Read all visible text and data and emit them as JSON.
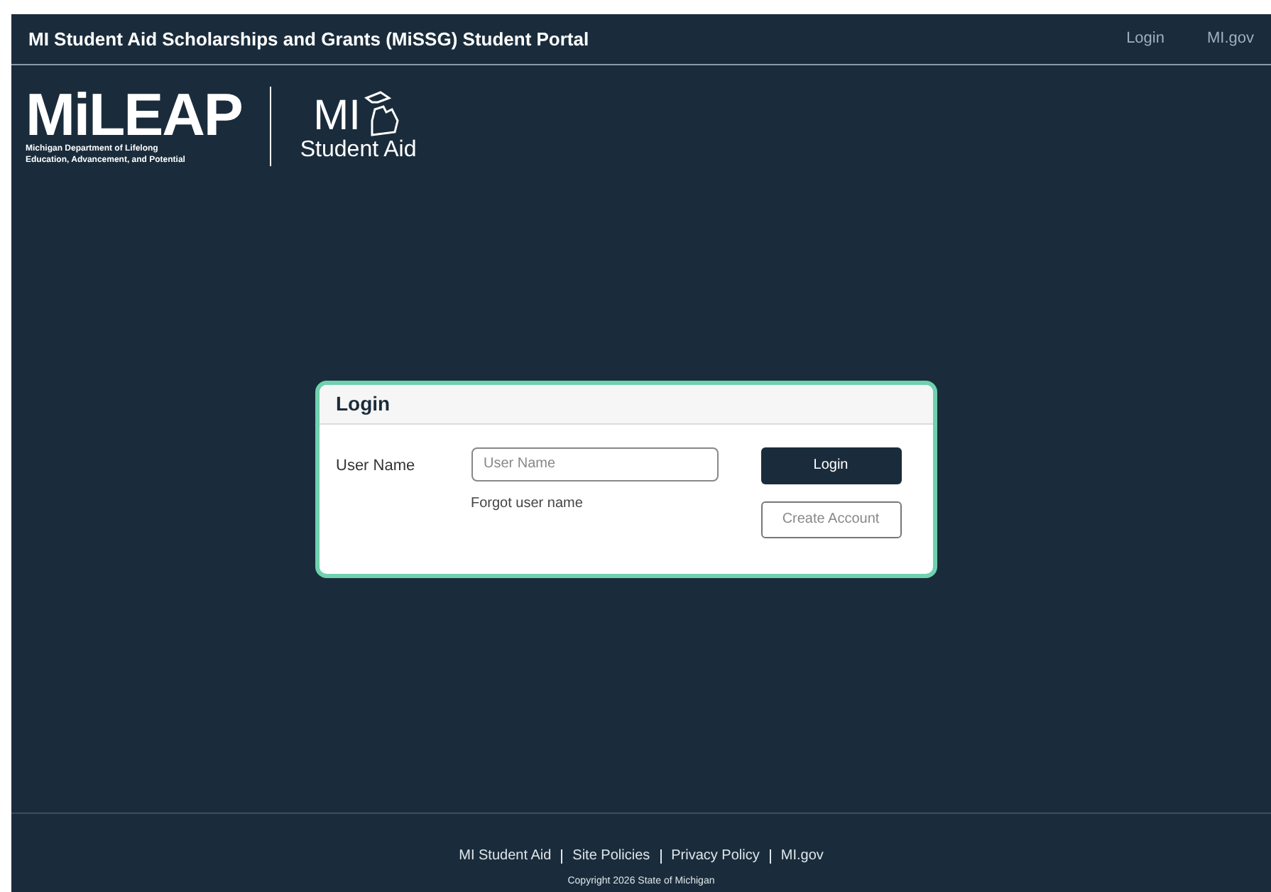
{
  "header": {
    "title": "MI Student Aid Scholarships and Grants (MiSSG) Student Portal",
    "links": [
      "Login",
      "MI.gov"
    ]
  },
  "logos": {
    "mileap": {
      "wordmark": "MiLEAP",
      "tagline_1": "Michigan Department of Lifelong",
      "tagline_2": "Education, Advancement, and Potential"
    },
    "student_aid": {
      "mark": "MI",
      "name": "Student Aid"
    }
  },
  "login": {
    "title": "Login",
    "label": "User Name",
    "username": {
      "placeholder": "User Name"
    },
    "forgot_link": "Forgot user name",
    "buttons": [
      {
        "label": "Login",
        "kind": "primary"
      },
      {
        "label": "Create Account",
        "kind": "secondary"
      }
    ]
  },
  "footer": {
    "links": [
      "MI Student Aid",
      "Site Policies",
      "Privacy Policy",
      "MI.gov"
    ],
    "copyright": "Copyright 2026 State of Michigan"
  }
}
